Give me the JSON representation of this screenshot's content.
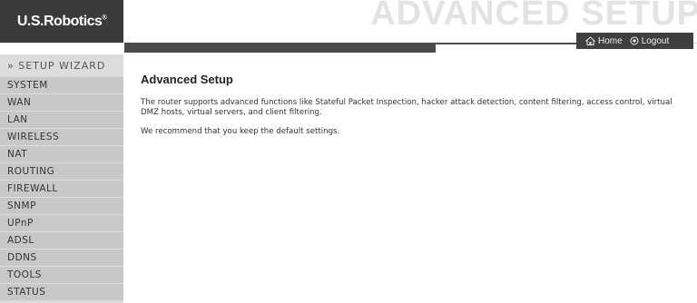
{
  "header": {
    "logo": "U.S.Robotics",
    "logo_mark": "®",
    "watermark": "ADVANCED SETUP",
    "links": [
      {
        "label": "Home",
        "icon": "home-icon"
      },
      {
        "label": "Logout",
        "icon": "logout-icon"
      }
    ]
  },
  "sidebar": {
    "wizard": "» SETUP WIZARD",
    "items": [
      {
        "label": "SYSTEM"
      },
      {
        "label": "WAN"
      },
      {
        "label": "LAN"
      },
      {
        "label": "WIRELESS"
      },
      {
        "label": "NAT"
      },
      {
        "label": "ROUTING"
      },
      {
        "label": "FIREWALL"
      },
      {
        "label": "SNMP"
      },
      {
        "label": "UPnP"
      },
      {
        "label": "ADSL"
      },
      {
        "label": "DDNS"
      },
      {
        "label": "TOOLS"
      },
      {
        "label": "STATUS"
      }
    ]
  },
  "main": {
    "title": "Advanced Setup",
    "paragraphs": [
      "The router supports advanced functions like Stateful Packet Inspection, hacker attack detection, content filtering, access control, virtual DMZ hosts, virtual servers, and client filtering.",
      "We recommend that you keep the default settings."
    ]
  },
  "colors": {
    "header_dark": "#3a3a3a",
    "sidebar_bg": "#dcdcdc",
    "nav_item_bg": "#c8c8c8",
    "watermark": "#e3e3e3"
  }
}
